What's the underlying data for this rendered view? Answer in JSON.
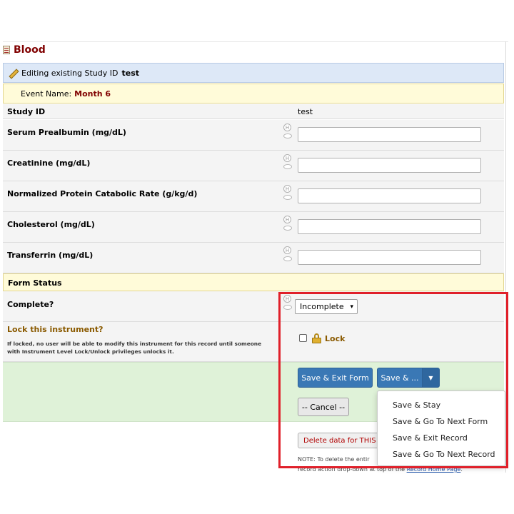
{
  "instrument": {
    "title": "Blood"
  },
  "record_bar": {
    "prefix": "Editing existing Study ID",
    "record_id": "test"
  },
  "event_bar": {
    "label": "Event Name:",
    "value": "Month 6"
  },
  "fields": {
    "study_id": {
      "label": "Study ID",
      "value": "test"
    },
    "serum_prealbumin": {
      "label": "Serum Prealbumin (mg/dL)",
      "value": ""
    },
    "creatinine": {
      "label": "Creatinine (mg/dL)",
      "value": ""
    },
    "npcr": {
      "label": "Normalized Protein Catabolic Rate (g/kg/d)",
      "value": ""
    },
    "cholesterol": {
      "label": "Cholesterol (mg/dL)",
      "value": ""
    },
    "transferrin": {
      "label": "Transferrin (mg/dL)",
      "value": ""
    }
  },
  "form_status": {
    "section_label": "Form Status",
    "complete_label": "Complete?",
    "complete_value": "Incomplete"
  },
  "lock": {
    "title": "Lock this instrument?",
    "description": "If locked, no user will be able to modify this instrument for this record until someone with Instrument Level Lock/Unlock privileges unlocks it.",
    "checkbox_label": "Lock",
    "checked": false
  },
  "buttons": {
    "save_exit_form": "Save & Exit Form",
    "save_more": "Save & ...",
    "cancel": "-- Cancel --",
    "delete_data": "Delete data for THIS f"
  },
  "save_menu": [
    "Save & Stay",
    "Save & Go To Next Form",
    "Save & Exit Record",
    "Save & Go To Next Record"
  ],
  "note": {
    "line1": "NOTE: To delete the entir",
    "line2_pre": "record action drop-down at top of the ",
    "line2_link": "Record Home Page",
    "line2_post": "."
  },
  "icons": {
    "history": "history-H-icon",
    "comment": "comment-bubble-icon",
    "edit": "pencil-icon",
    "form": "form-icon",
    "lock": "padlock-icon"
  },
  "colors": {
    "title": "#800000",
    "primary_button": "#3a78b5",
    "highlight_frame": "#e0202a",
    "save_area": "#dff2d8"
  }
}
